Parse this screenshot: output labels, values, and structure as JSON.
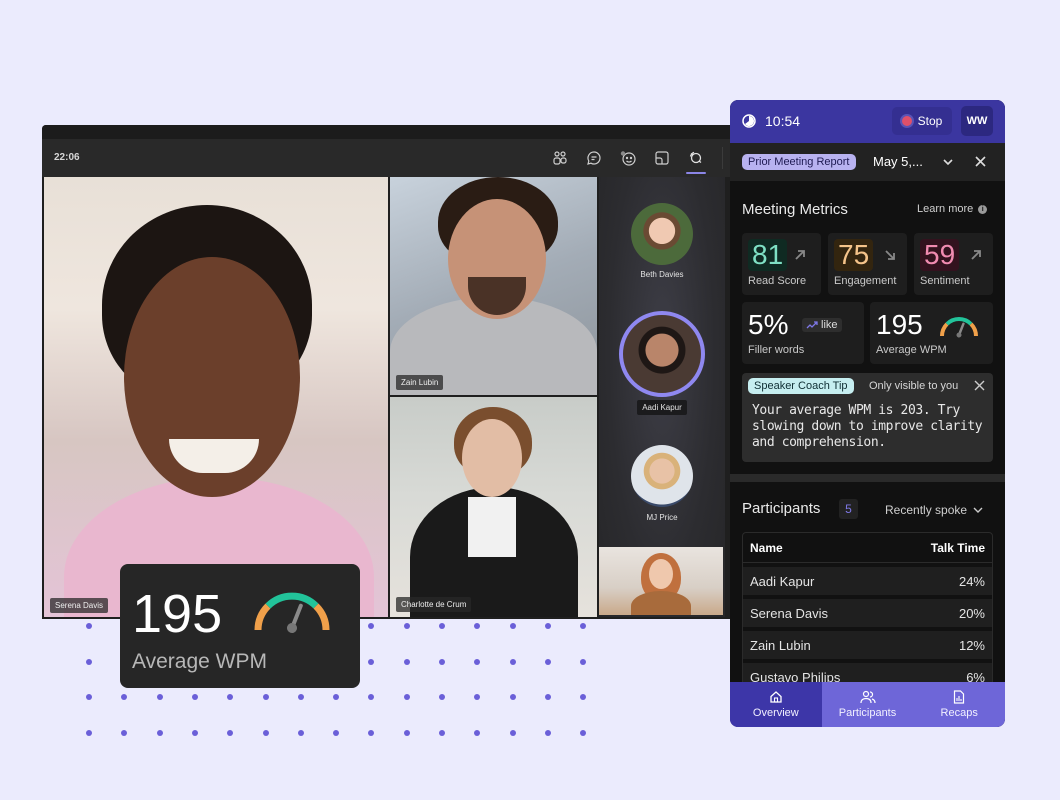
{
  "call": {
    "clock": "22:06",
    "toolbar_icons": [
      "people-icon",
      "chat-icon",
      "reactions-icon",
      "share-screen-icon",
      "speaker-coach-icon"
    ],
    "active_toolbar_icon": "speaker-coach-icon",
    "tiles": [
      {
        "name": "Serena Davis"
      },
      {
        "name": "Zain Lubin"
      },
      {
        "name": "Charlotte de Crum"
      }
    ],
    "strip": [
      {
        "name": "Beth Davies",
        "speaking": false
      },
      {
        "name": "Aadi Kapur",
        "speaking": true
      },
      {
        "name": "MJ Price",
        "speaking": false
      }
    ]
  },
  "wpm_card": {
    "value": "195",
    "label": "Average WPM",
    "gauge_level": 0.62
  },
  "panel": {
    "timer": "10:54",
    "stop_label": "Stop",
    "user_initials": "WW",
    "report_chip": "Prior Meeting Report",
    "date": "May 5,...",
    "metrics_title": "Meeting Metrics",
    "learn_more": "Learn more",
    "metrics": [
      {
        "value": "81",
        "label": "Read Score",
        "trend": "up",
        "color": "#7fe0c4",
        "bg": "#0f2a22"
      },
      {
        "value": "75",
        "label": "Engagement",
        "trend": "down",
        "color": "#f5c48a",
        "bg": "#33250f"
      },
      {
        "value": "59",
        "label": "Sentiment",
        "trend": "up",
        "color": "#f08bb0",
        "bg": "#33121e"
      }
    ],
    "filler": {
      "value": "5%",
      "label": "Filler words",
      "top_word": "like"
    },
    "wpm": {
      "value": "195",
      "label": "Average WPM",
      "gauge_level": 0.62
    },
    "tip": {
      "chip": "Speaker Coach Tip",
      "visibility": "Only visible to you",
      "text": "Your average WPM is 203. Try slowing down to improve clarity and comprehension."
    },
    "participants": {
      "title": "Participants",
      "count": "5",
      "sort": "Recently spoke",
      "columns": [
        "Name",
        "Talk Time"
      ],
      "rows": [
        {
          "name": "Aadi Kapur",
          "talk": "24%"
        },
        {
          "name": "Serena Davis",
          "talk": "20%"
        },
        {
          "name": "Zain Lubin",
          "talk": "12%"
        },
        {
          "name": "Gustavo Philips",
          "talk": "6%"
        }
      ]
    },
    "nav": [
      {
        "label": "Overview",
        "icon": "home-icon",
        "active": true
      },
      {
        "label": "Participants",
        "icon": "people-icon",
        "active": false
      },
      {
        "label": "Recaps",
        "icon": "report-icon",
        "active": false
      }
    ]
  }
}
